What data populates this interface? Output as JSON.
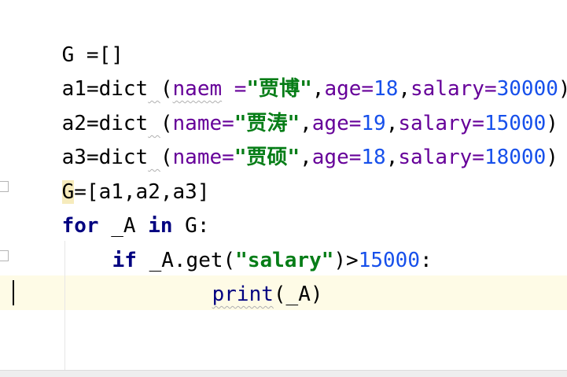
{
  "code": {
    "line1": {
      "var": "G",
      "op": " =",
      "value": "[]"
    },
    "line2": {
      "var": "a1",
      "eq": "=",
      "func": "dict",
      "space": " ",
      "open": "(",
      "k1": "naem",
      "k1_sep": " =",
      "v1": "\"贾博\"",
      "c1": ",",
      "k2": "age",
      "e2": "=",
      "v2": "18",
      "c2": ",",
      "k3": "salary",
      "e3": "=",
      "v3": "30000",
      "close": ")"
    },
    "line3": {
      "var": "a2",
      "eq": "=",
      "func": "dict",
      "space": " ",
      "open": "(",
      "k1": "name",
      "e1": "=",
      "v1": "\"贾涛\"",
      "c1": ",",
      "k2": "age",
      "e2": "=",
      "v2": "19",
      "c2": ",",
      "k3": "salary",
      "e3": "=",
      "v3": "15000",
      "close": ")"
    },
    "line4": {
      "var": "a3",
      "eq": "=",
      "func": "dict",
      "space": " ",
      "open": "(",
      "k1": "name",
      "e1": "=",
      "v1": "\"贾硕\"",
      "c1": ",",
      "k2": "age",
      "e2": "=",
      "v2": "18",
      "c2": ",",
      "k3": "salary",
      "e3": "=",
      "v3": "18000",
      "close": ")"
    },
    "line5": {
      "var": "G",
      "rest": "=[a1,a2,a3]"
    },
    "line6": {
      "kw_for": "for",
      "mid": " _A ",
      "kw_in": "in",
      "tail": " G:"
    },
    "line7": {
      "kw_if": "if",
      "pre": " _A.get(",
      "str": "\"salary\"",
      "gt": ")>",
      "num": "15000",
      "colon": ":"
    },
    "line8": {
      "func": "print",
      "args": "(_A)"
    }
  },
  "colors": {
    "keyword": "#000080",
    "string": "#067d17",
    "number": "#1750eb",
    "kwarg": "#660099",
    "current_line": "#fefbe6"
  }
}
